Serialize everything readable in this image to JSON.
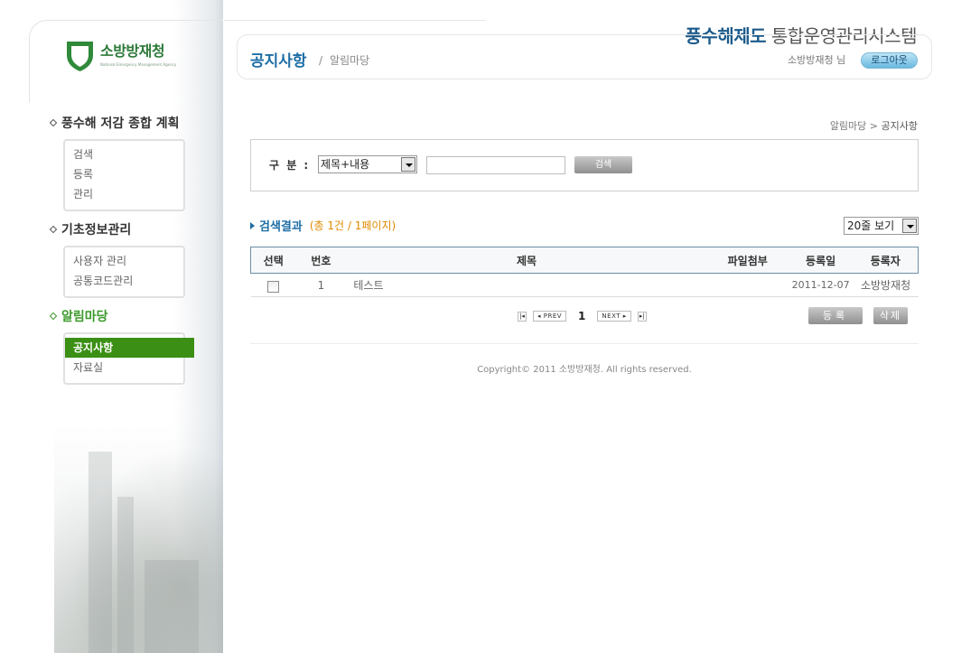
{
  "logo": {
    "name": "소방방재청",
    "subtitle": "National Emergency Management Agency"
  },
  "brand": {
    "part1": "풍수해제도",
    "part2": "통합운영관리시스템"
  },
  "header": {
    "page_title": "공지사항",
    "page_sub": "알림마당",
    "user": "소방방재청 님",
    "logout": "로그아웃"
  },
  "breadcrumb": {
    "parent": "알림마당",
    "sep": ">",
    "current": "공지사항"
  },
  "nav": [
    {
      "title": "풍수해 저감 종합 계획",
      "items": [
        "검색",
        "등록",
        "관리"
      ]
    },
    {
      "title": "기초정보관리",
      "items": [
        "사용자 관리",
        "공통코드관리"
      ]
    },
    {
      "title": "알림마당",
      "items": [
        "공지사항",
        "자료실"
      ]
    }
  ],
  "search": {
    "label": "구 분 :",
    "selected": "제목+내용",
    "keyword": "",
    "button": "검색"
  },
  "results": {
    "title": "검색결과",
    "count": "(총 1건 / 1페이지)",
    "rows_per_page": "20줄 보기"
  },
  "table": {
    "headers": [
      "선택",
      "번호",
      "제목",
      "파일첨부",
      "등록일",
      "등록자"
    ],
    "rows": [
      {
        "no": "1",
        "title": "테스트",
        "file": "",
        "date": "2011-12-07",
        "author": "소방방재청"
      }
    ]
  },
  "pager": {
    "first": "|◂",
    "prev": "◂ PREV",
    "current": "1",
    "next": "NEXT ▸",
    "last": "▸|"
  },
  "actions": {
    "register": "등록",
    "delete": "삭제"
  },
  "footer": {
    "copyright": "Copyright© 2011 소방방재청. All rights reserved."
  },
  "colors": {
    "primary": "#1e6ea5",
    "accent_green": "#3a8f14",
    "count_orange": "#e08a00"
  }
}
